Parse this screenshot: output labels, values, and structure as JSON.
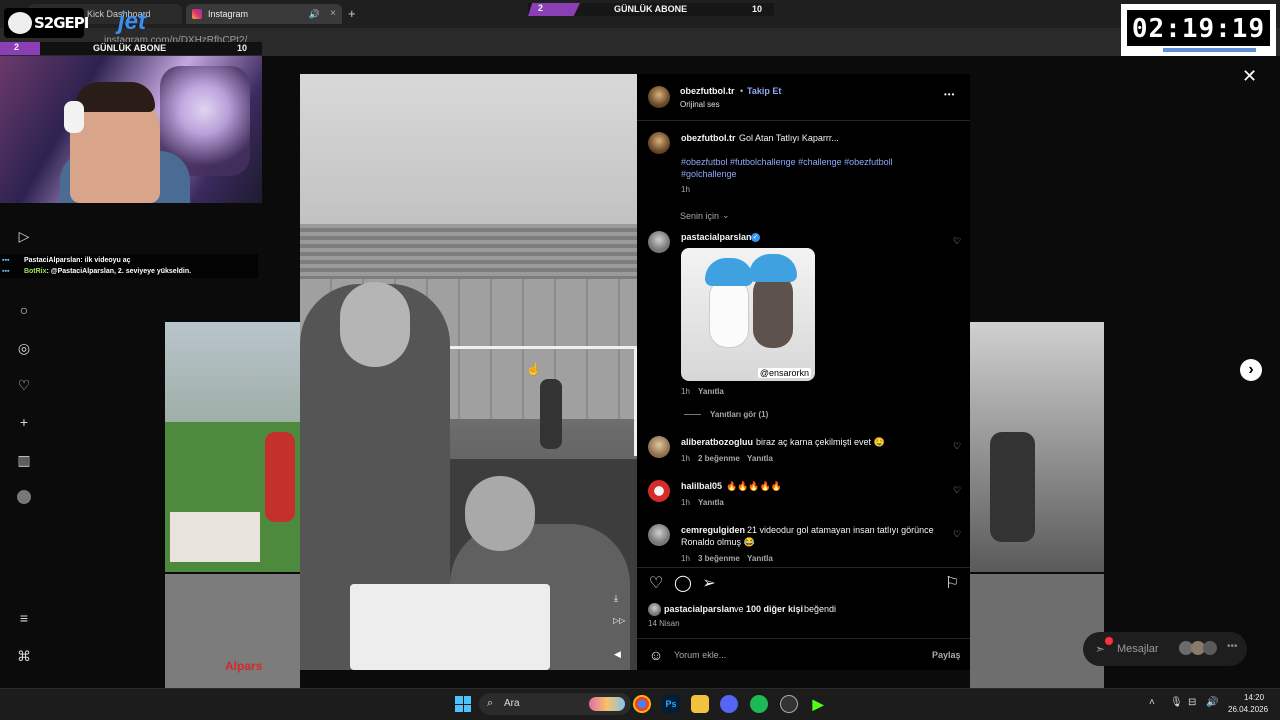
{
  "browser": {
    "tabs": [
      {
        "label": "Stream - Kick Dashboard"
      },
      {
        "label": "Instagram"
      }
    ],
    "new_tab": "+",
    "close": "×",
    "url": "instagram.com/p/DXHzRfhCPt2/"
  },
  "stream_overlay": {
    "logo_text": "S2GEPI",
    "sponsor": "jet",
    "sub_left": {
      "count": "2",
      "label": "GÜNLÜK ABONE",
      "goal": "10"
    },
    "sub_top": {
      "count": "2",
      "label": "GÜNLÜK ABONE",
      "goal": "10"
    },
    "timer": "02:19:19",
    "chat": [
      {
        "user": "PastaciAlparslan",
        "message": ": ilk videoyu aç"
      },
      {
        "user": "BotRix",
        "message": ": @PastaciAlparslan, 2. seviyeye yükseldin."
      }
    ]
  },
  "post": {
    "author": "obezfutbol.tr",
    "follow": "Takip Et",
    "audio": "Orijinal ses",
    "more": "•••",
    "caption_user": "obezfutbol.tr",
    "caption": "Gol Atan Tatlıyı Kaparrr...",
    "hashtags_line1": "#obezfutbol #futbolchallenge #challenge #obezfutboll",
    "hashtags_line2": "#golchallenge",
    "caption_time": "1h",
    "filter": "Senin için",
    "comments": [
      {
        "user": "pastacialparslan",
        "verified": true,
        "text": "",
        "time": "1h",
        "likes": "",
        "reply": "Yanıtla",
        "gif_watermark": "@ensarorkn",
        "view_replies": "Yanıtları gör (1)"
      },
      {
        "user": "aliberatbozogluu",
        "text": "biraz aç karna çekilmişti evet 🤤",
        "time": "1h",
        "likes": "2 beğenme",
        "reply": "Yanıtla"
      },
      {
        "user": "halilbal05",
        "text": "🔥🔥🔥🔥🔥",
        "time": "1h",
        "likes": "",
        "reply": "Yanıtla"
      },
      {
        "user": "cemregulgiden",
        "text_line1": "21 videodur gol atamayan insan tatlıyı görünce",
        "text_line2": "Ronaldo olmuş 😂",
        "time": "1h",
        "likes": "3 beğenme",
        "reply": "Yanıtla"
      }
    ],
    "liked_by_user": "pastacialparslan",
    "liked_by_and": "ve",
    "liked_by_others": "100 diğer kişi",
    "liked_by_suffix": "beğendi",
    "date": "14 Nisan",
    "comment_placeholder": "Yorum ekle...",
    "share": "Paylaş"
  },
  "right_widget": {
    "messages": "Mesajlar"
  },
  "taskbar": {
    "search": "Ara",
    "time": "14:20",
    "date": "26.04.2026"
  },
  "colors": {
    "accent_purple": "#8b3fb5",
    "link_blue": "#8fa8f5",
    "instagram_bg": "#000000"
  }
}
